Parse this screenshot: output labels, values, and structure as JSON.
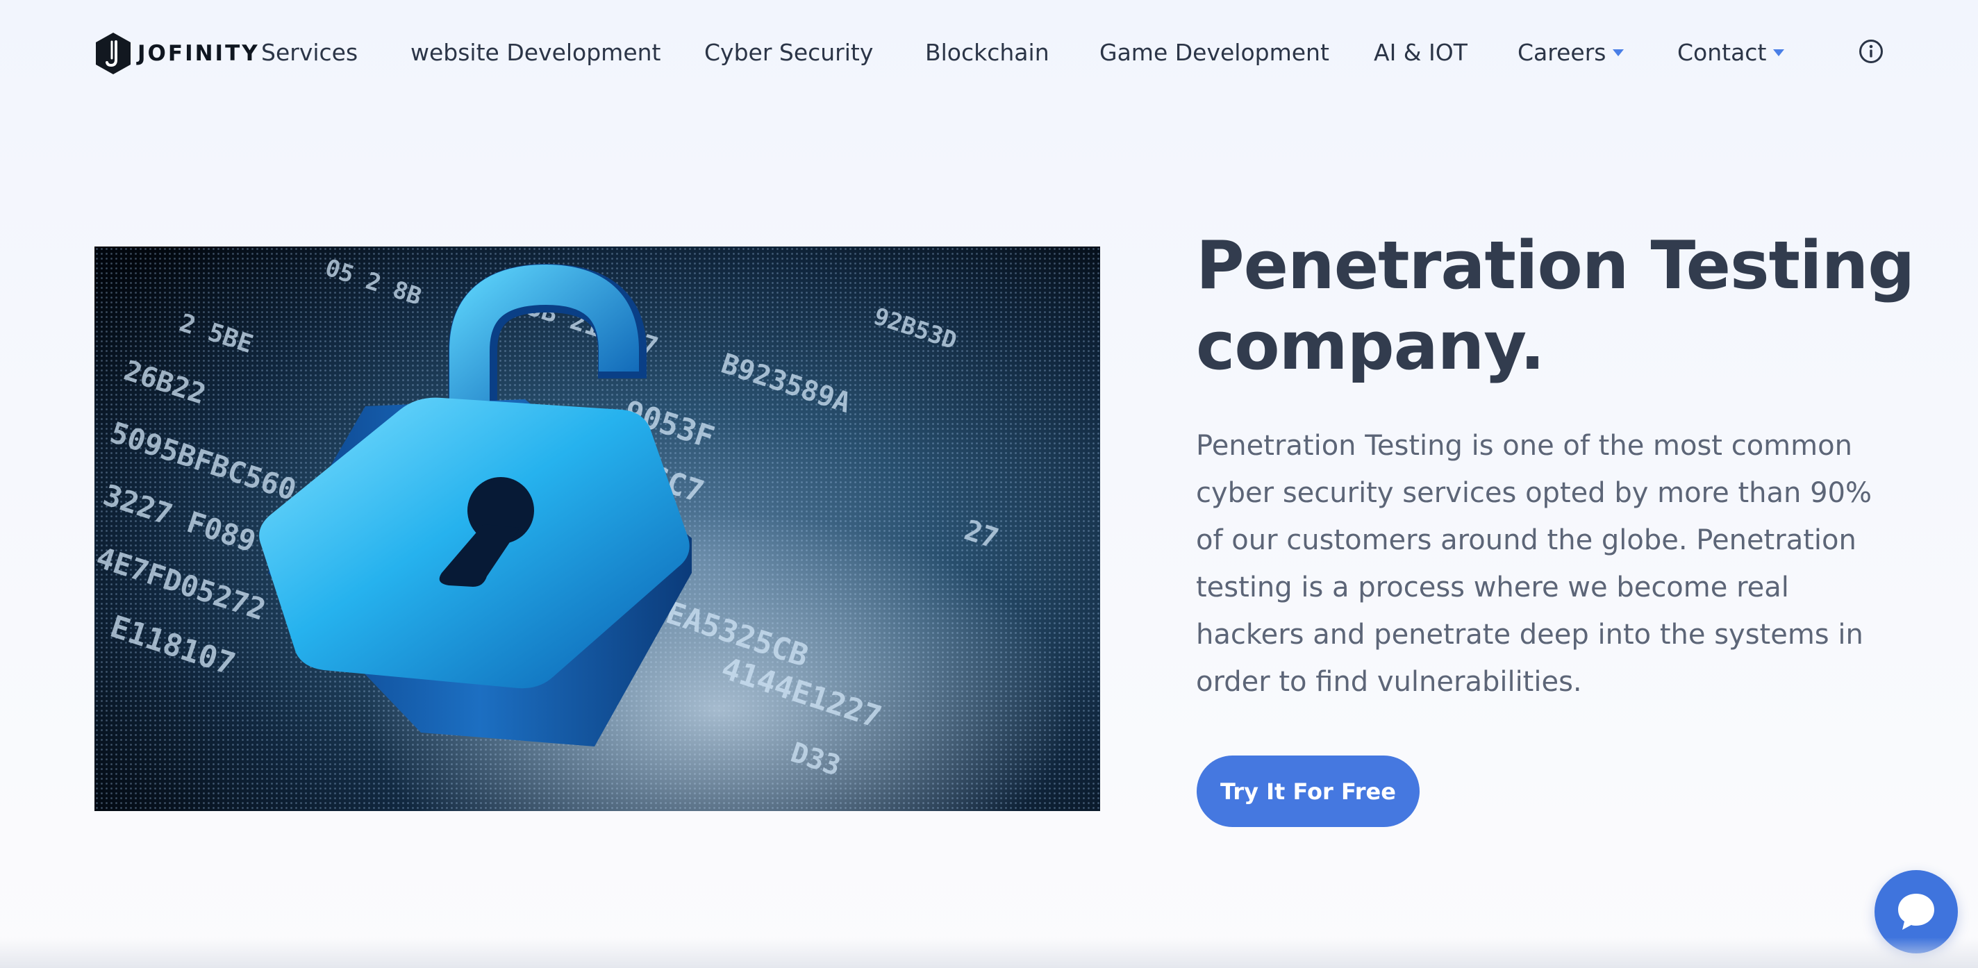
{
  "header": {
    "brand_name": "JOFINITY",
    "logo_icon": "jofinity-logo-icon",
    "nav": [
      {
        "label": "Services",
        "has_dropdown": false
      },
      {
        "label": "website Development",
        "has_dropdown": false
      },
      {
        "label": "Cyber Security",
        "has_dropdown": false
      },
      {
        "label": "Blockchain",
        "has_dropdown": false
      },
      {
        "label": "Game Development",
        "has_dropdown": false
      },
      {
        "label": "AI & IOT",
        "has_dropdown": false
      },
      {
        "label": "Careers",
        "has_dropdown": true
      },
      {
        "label": "Contact",
        "has_dropdown": true
      }
    ],
    "info_icon": "info-icon"
  },
  "hero": {
    "title_line1": "Penetration Testing",
    "title_line2": "company.",
    "description": "Penetration Testing is one of the most common cyber security services opted by more than 90% of our customers around the globe. Penetration testing is a process where we become real hackers and penetrate deep into the systems in order to find vulnerabilities.",
    "cta_label": "Try It For Free",
    "image_icon": "unlocked-padlock-icon"
  },
  "chat": {
    "icon": "chat-bubble-icon"
  },
  "colors": {
    "accent": "#4578e0",
    "heading": "#323c4e",
    "body_text": "#5c6577",
    "background": "#f4f6fc"
  }
}
